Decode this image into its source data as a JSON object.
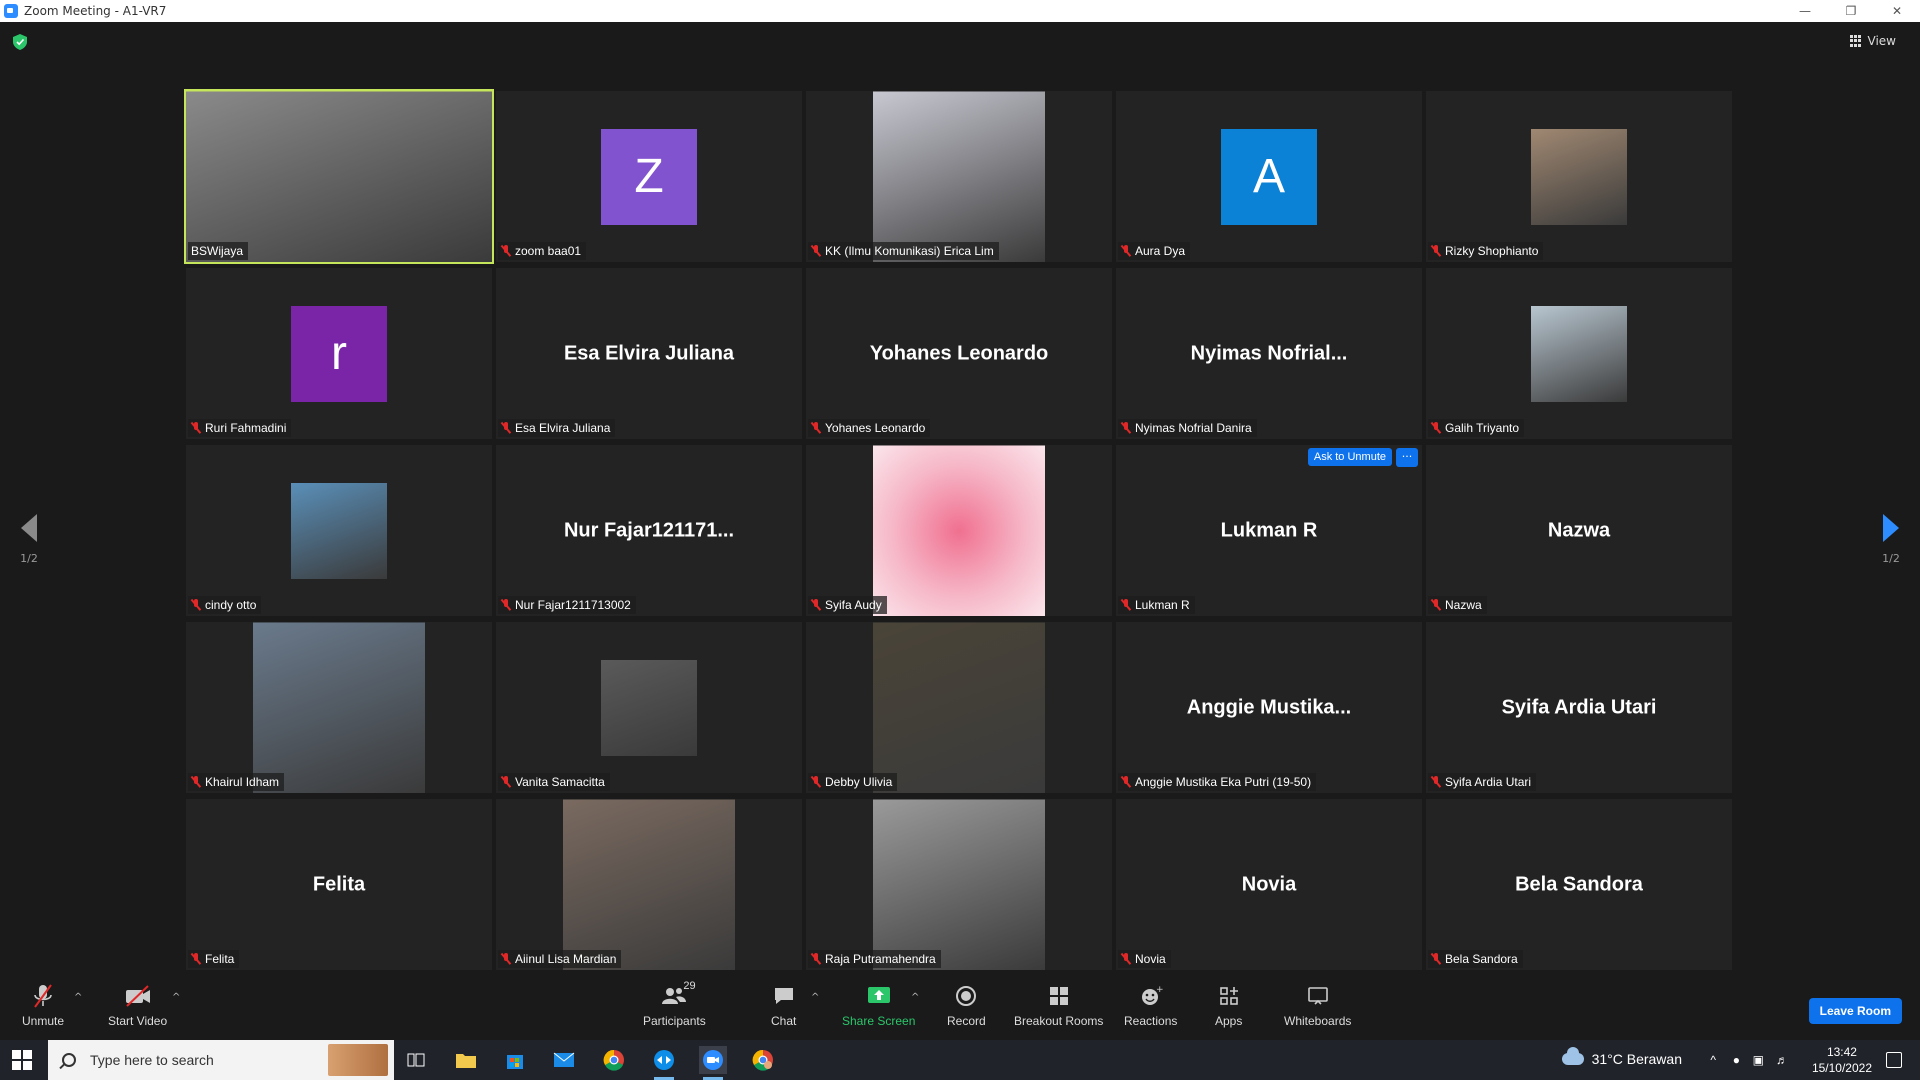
{
  "window": {
    "title": "Zoom Meeting - A1-VR7"
  },
  "meeting": {
    "view_label": "View",
    "page_indicator_left": "1/2",
    "page_indicator_right": "1/2",
    "ask_to_unmute_label": "Ask to Unmute",
    "more_label": "···"
  },
  "tiles": [
    {
      "name": "BSWijaya",
      "kind": "photo-large",
      "muted": false,
      "active": true,
      "bg": "#8a8a8a"
    },
    {
      "name": "zoom baa01",
      "kind": "avatar",
      "letter": "Z",
      "color": "#8253ce",
      "muted": true
    },
    {
      "name": "KK (Ilmu Komunikasi) Erica Lim",
      "kind": "photo-large",
      "muted": true,
      "bg": "#c8c8d2"
    },
    {
      "name": "Aura Dya",
      "kind": "avatar",
      "letter": "A",
      "color": "#0b82d6",
      "muted": true
    },
    {
      "name": "Rizky Shophianto",
      "kind": "photo-small",
      "muted": true,
      "bg": "#a08872"
    },
    {
      "name": "Ruri Fahmadini",
      "kind": "avatar",
      "letter": "r",
      "color": "#7a25a8",
      "muted": true
    },
    {
      "name": "Esa Elvira Juliana",
      "kind": "text",
      "display": "Esa Elvira Juliana",
      "muted": true
    },
    {
      "name": "Yohanes Leonardo",
      "kind": "text",
      "display": "Yohanes Leonardo",
      "muted": true
    },
    {
      "name": "Nyimas Nofrial Danira",
      "kind": "text",
      "display": "Nyimas  Nofrial...",
      "muted": true
    },
    {
      "name": "Galih Triyanto",
      "kind": "photo-small",
      "muted": true,
      "bg": "#b8c6d0"
    },
    {
      "name": "cindy otto",
      "kind": "photo-small",
      "muted": true,
      "bg": "#5a8fb8"
    },
    {
      "name": "Nur Fajar1211713002",
      "kind": "text",
      "display": "Nur  Fajar121171...",
      "muted": true
    },
    {
      "name": "Syifa Audy",
      "kind": "photo-pink",
      "muted": true,
      "bg": "#f07090"
    },
    {
      "name": "Lukman R",
      "kind": "text",
      "display": "Lukman R",
      "muted": true,
      "ask": true
    },
    {
      "name": "Nazwa",
      "kind": "text",
      "display": "Nazwa",
      "muted": true
    },
    {
      "name": "Khairul Idham",
      "kind": "photo-large",
      "muted": true,
      "bg": "#6a7a8c"
    },
    {
      "name": "Vanita Samacitta",
      "kind": "photo-small",
      "muted": true,
      "bg": "#5a5a5a"
    },
    {
      "name": "Debby Ulivia",
      "kind": "photo-large",
      "muted": true,
      "bg": "#4a4438"
    },
    {
      "name": "Anggie Mustika Eka Putri (19-50)",
      "kind": "text",
      "display": "Anggie  Mustika...",
      "muted": true
    },
    {
      "name": "Syifa Ardia Utari",
      "kind": "text",
      "display": "Syifa Ardia Utari",
      "muted": true
    },
    {
      "name": "Felita",
      "kind": "text",
      "display": "Felita",
      "muted": true
    },
    {
      "name": "Aiinul Lisa Mardian",
      "kind": "photo-large",
      "muted": true,
      "bg": "#7a6a60"
    },
    {
      "name": "Raja Putramahendra",
      "kind": "photo-large",
      "muted": true,
      "bg": "#9a9a9a"
    },
    {
      "name": "Novia",
      "kind": "text",
      "display": "Novia",
      "muted": true
    },
    {
      "name": "Bela Sandora",
      "kind": "text",
      "display": "Bela Sandora",
      "muted": true
    }
  ],
  "toolbar": {
    "unmute": "Unmute",
    "start_video": "Start Video",
    "participants": "Participants",
    "participants_count": "29",
    "chat": "Chat",
    "share_screen": "Share Screen",
    "record": "Record",
    "breakout_rooms": "Breakout Rooms",
    "reactions": "Reactions",
    "apps": "Apps",
    "whiteboards": "Whiteboards",
    "leave": "Leave Room"
  },
  "taskbar": {
    "search_placeholder": "Type here to search",
    "weather": "31°C  Berawan",
    "time": "13:42",
    "date": "15/10/2022"
  },
  "colors": {
    "accent": "#0e72ed",
    "active_speaker": "#c5e55a",
    "muted": "#e02828",
    "share": "#2bc66a"
  }
}
